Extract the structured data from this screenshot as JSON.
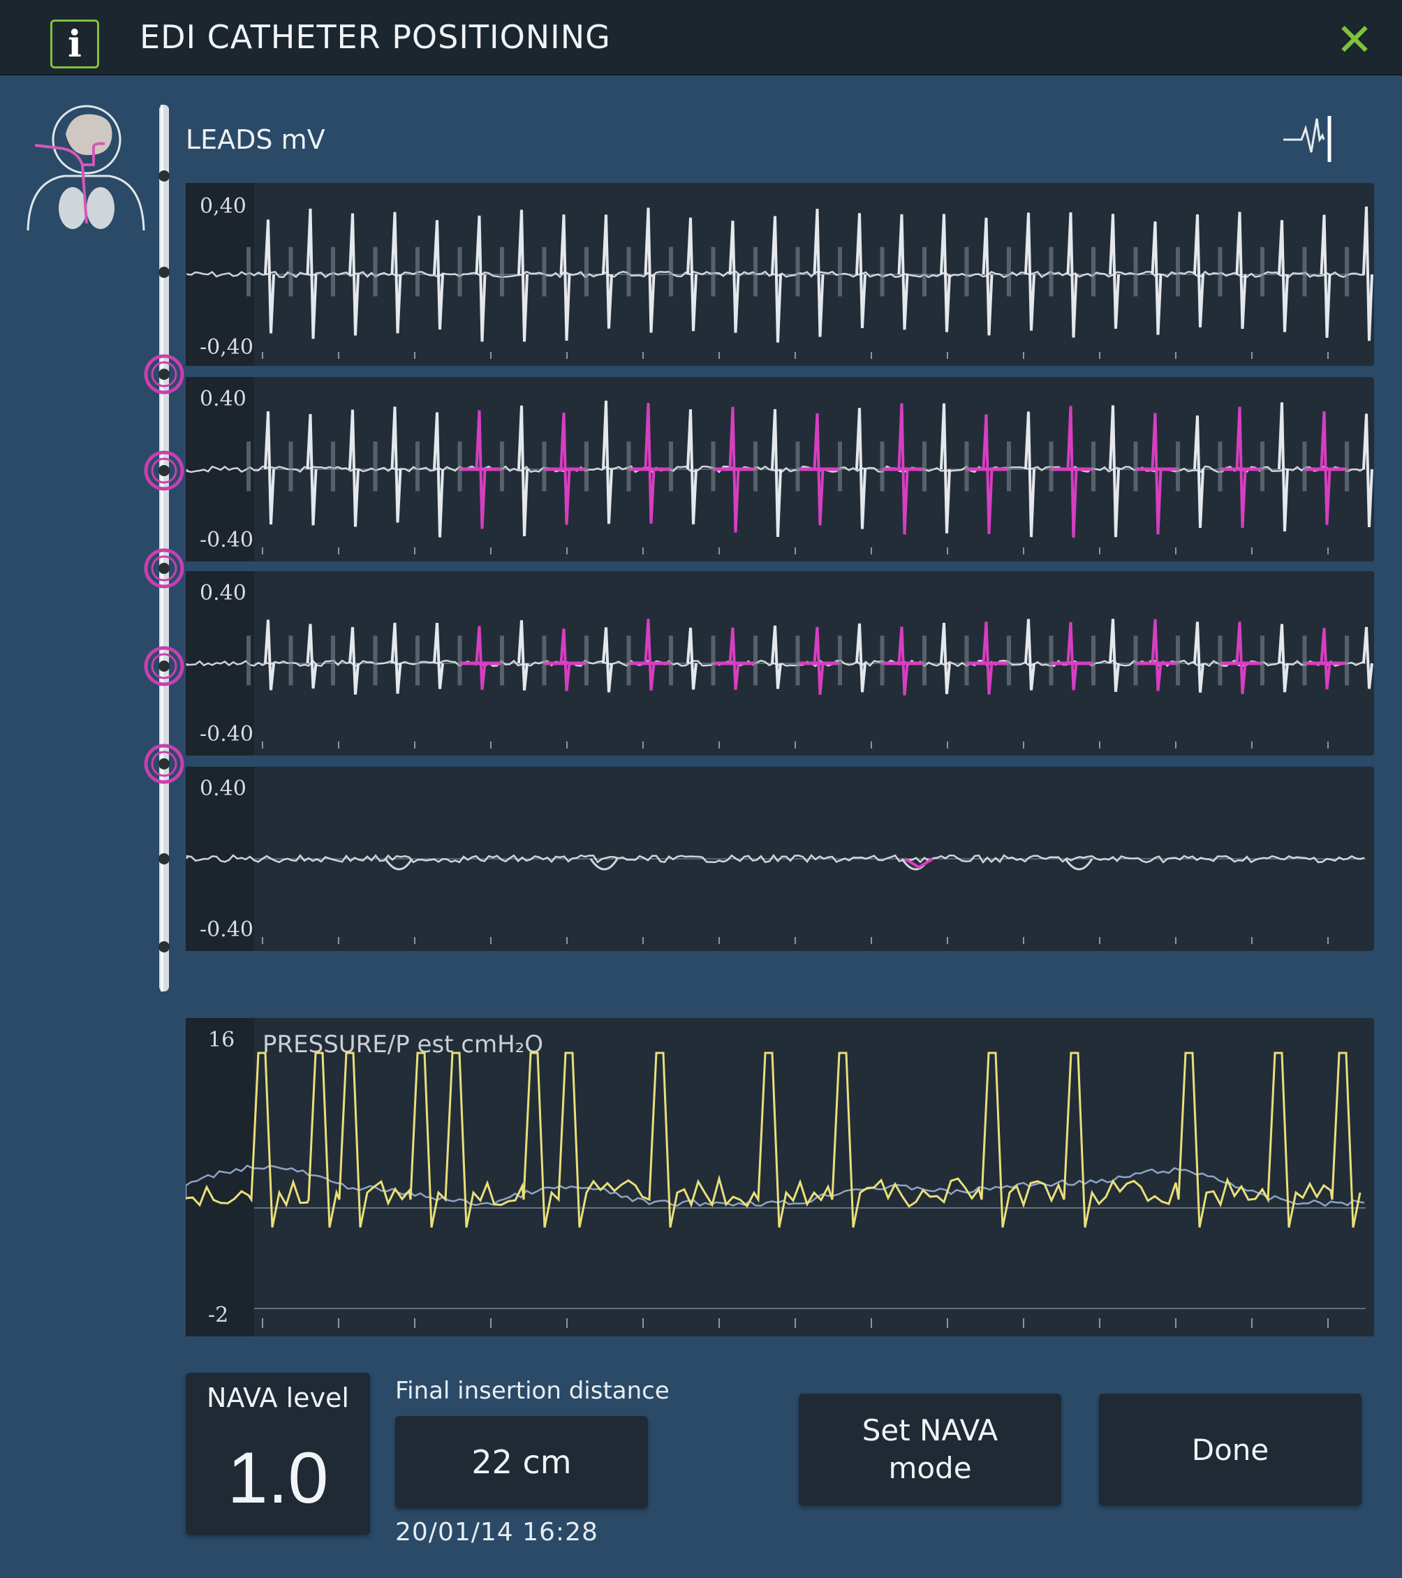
{
  "header": {
    "info_glyph": "i",
    "title": "EDI CATHETER POSITIONING",
    "close_glyph": "✕"
  },
  "icons": {
    "info": "info-icon",
    "close": "close-icon",
    "patient": "patient-airway-icon",
    "waveform": "waveform-toggle-icon",
    "catheter": "catheter-icon"
  },
  "leads": {
    "title": "LEADS mV",
    "panels": [
      {
        "top_scale": "0,40",
        "bottom_scale": "-0,40",
        "highlight": false,
        "activity": "strong"
      },
      {
        "top_scale": "0.40",
        "bottom_scale": "-0.40",
        "highlight": true,
        "activity": "strong"
      },
      {
        "top_scale": "0.40",
        "bottom_scale": "-0.40",
        "highlight": true,
        "activity": "medium"
      },
      {
        "top_scale": "0.40",
        "bottom_scale": "-0.40",
        "highlight": false,
        "activity": "low"
      }
    ]
  },
  "pressure": {
    "title": "PRESSURE/P est cmH₂O",
    "top_scale": "16",
    "bottom_scale": "-2"
  },
  "nava": {
    "label": "NAVA level",
    "value": "1.0"
  },
  "insertion": {
    "label": "Final insertion distance",
    "value": "22 cm",
    "timestamp": "20/01/14 16:28"
  },
  "buttons": {
    "set_nava": "Set NAVA\nmode",
    "done": "Done"
  },
  "colors": {
    "background": "#2b4a68",
    "titlebar": "#1c262f",
    "panel": "#232d38",
    "accent_green": "#7ec23e",
    "trace_white": "#e4e8ec",
    "highlight_magenta": "#d63fc0",
    "pressure_yellow": "#e9e07a",
    "pressure_blue": "#8ea4c6"
  }
}
